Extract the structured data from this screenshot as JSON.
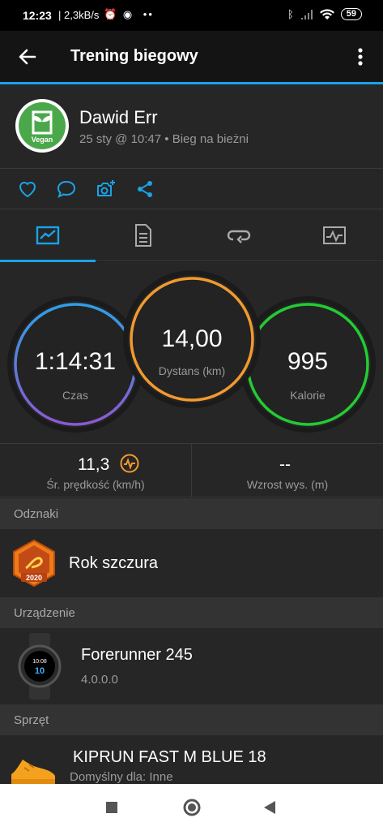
{
  "status_bar": {
    "time": "12:23",
    "net_speed": "2,3kB/s",
    "battery": "59",
    "icons": [
      "alarm-icon",
      "spotify-icon",
      "more-dots-icon",
      "bluetooth-icon",
      "signal-icon",
      "wifi-icon",
      "battery-icon"
    ]
  },
  "app_bar": {
    "title": "Trening biegowy",
    "back_icon": "arrow-left-icon",
    "menu_icon": "more-vertical-icon"
  },
  "activity": {
    "user_name": "Dawid Err",
    "avatar_label": "Vegan",
    "subtitle": "25 sty @ 10:47 • Bieg na bieżni"
  },
  "actions": [
    "heart-icon",
    "comment-icon",
    "add-photo-icon",
    "share-icon"
  ],
  "tabs": [
    "overview-tab",
    "details-tab",
    "laps-tab",
    "charts-tab"
  ],
  "circles": {
    "time": {
      "value": "1:14:31",
      "label": "Czas"
    },
    "distance": {
      "value": "14,00",
      "label": "Dystans (km)"
    },
    "calories": {
      "value": "995",
      "label": "Kalorie"
    }
  },
  "stats": {
    "avg_speed": {
      "value": "11,3",
      "label": "Śr. prędkość (km/h)"
    },
    "elevation": {
      "value": "--",
      "label": "Wzrost wys. (m)"
    }
  },
  "badges": {
    "header": "Odznaki",
    "item": {
      "name": "Rok szczura",
      "badge_year": "2020"
    }
  },
  "device": {
    "header": "Urządzenie",
    "name": "Forerunner 245",
    "version": "4.0.0.0",
    "watch_time_top": "10:08",
    "watch_time_main": "10"
  },
  "gear": {
    "header": "Sprzęt",
    "name": "KIPRUN FAST M BLUE 18",
    "default_for": "Domyślny dla: Inne"
  },
  "colors": {
    "accent": "#1aa3e8",
    "time_ring": "#6b7cd6",
    "distance_ring": "#f29a2e",
    "calories_ring": "#22cc33",
    "avatar": "#4aa84a"
  }
}
